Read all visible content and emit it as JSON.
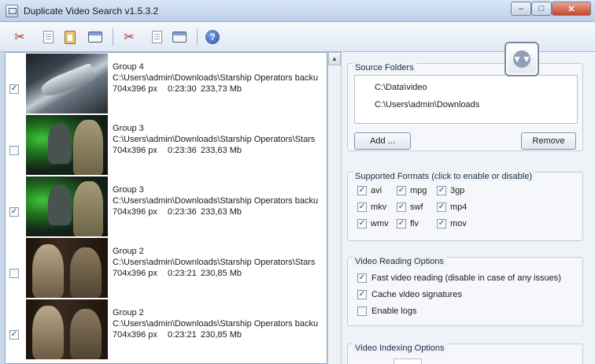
{
  "window": {
    "title": "Duplicate Video Search v1.5.3.2"
  },
  "titlebar_buttons": {
    "minimize": "–",
    "maximize": "□",
    "close": "✕"
  },
  "toolbar": {
    "icons": [
      "scissors-icon",
      "page-icon",
      "clipboard-icon",
      "window-icon",
      "scissors-icon",
      "page-icon",
      "window-icon",
      "help-icon"
    ],
    "help_label": "?"
  },
  "results": [
    {
      "checked": true,
      "group": "Group 4",
      "path": "C:\\Users\\admin\\Downloads\\Starship Operators backu",
      "resolution": "704x396 px",
      "duration": "0:23:30",
      "size": "233,73 Mb",
      "thumb": "ship"
    },
    {
      "checked": false,
      "group": "Group 3",
      "path": "C:\\Users\\admin\\Downloads\\Starship Operators\\Stars",
      "resolution": "704x396 px",
      "duration": "0:23:36",
      "size": "233,63 Mb",
      "thumb": "green"
    },
    {
      "checked": true,
      "group": "Group 3",
      "path": "C:\\Users\\admin\\Downloads\\Starship Operators backu",
      "resolution": "704x396 px",
      "duration": "0:23:36",
      "size": "233,63 Mb",
      "thumb": "green"
    },
    {
      "checked": false,
      "group": "Group 2",
      "path": "C:\\Users\\admin\\Downloads\\Starship Operators\\Stars",
      "resolution": "704x396 px",
      "duration": "0:23:21",
      "size": "230,85 Mb",
      "thumb": "brown"
    },
    {
      "checked": true,
      "group": "Group 2",
      "path": "C:\\Users\\admin\\Downloads\\Starship Operators backu",
      "resolution": "704x396 px",
      "duration": "0:23:21",
      "size": "230,85 Mb",
      "thumb": "brown"
    }
  ],
  "check_mark": "✓",
  "source_folders": {
    "title": "Source Folders",
    "folders": [
      "C:\\Data\\video",
      "C:\\Users\\admin\\Downloads"
    ],
    "add_label": "Add ...",
    "remove_label": "Remove"
  },
  "formats": {
    "title": "Supported Formats (click to enable or disable)",
    "items": [
      {
        "label": "avi",
        "checked": true
      },
      {
        "label": "mpg",
        "checked": true
      },
      {
        "label": "3gp",
        "checked": true
      },
      {
        "label": "mkv",
        "checked": true
      },
      {
        "label": "swf",
        "checked": true
      },
      {
        "label": "mp4",
        "checked": true
      },
      {
        "label": "wmv",
        "checked": true
      },
      {
        "label": "flv",
        "checked": true
      },
      {
        "label": "mov",
        "checked": true
      }
    ]
  },
  "reading_options": {
    "title": "Video Reading Options",
    "fast_reading": {
      "label": "Fast video reading (disable in case of any issues)",
      "checked": true
    },
    "cache_signatures": {
      "label": "Cache video signatures",
      "checked": true
    },
    "enable_logs": {
      "label": "Enable logs",
      "checked": false
    }
  },
  "indexing_options": {
    "title": "Video Indexing Options"
  },
  "scroll_up_glyph": "▲",
  "float_button_glyph": "▼▼"
}
